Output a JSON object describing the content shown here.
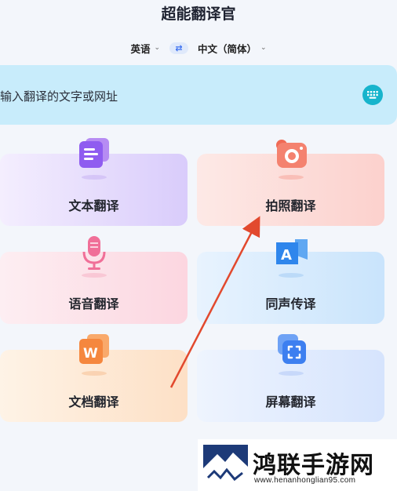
{
  "app": {
    "title": "超能翻译官"
  },
  "languages": {
    "source": "英语",
    "target": "中文（简体）"
  },
  "input": {
    "placeholder": "输入翻译的文字或网址"
  },
  "features": [
    {
      "label": "文本翻译",
      "icon": "document-text-icon"
    },
    {
      "label": "拍照翻译",
      "icon": "camera-icon"
    },
    {
      "label": "语音翻译",
      "icon": "microphone-icon"
    },
    {
      "label": "同声传译",
      "icon": "simultaneous-interpretation-icon"
    },
    {
      "label": "文档翻译",
      "icon": "word-document-icon"
    },
    {
      "label": "屏幕翻译",
      "icon": "screen-translate-icon"
    }
  ],
  "watermark": {
    "title": "鸿联手游网",
    "url": "www.henanhonglian95.com"
  },
  "colors": {
    "accent": "#17b4cc",
    "arrow": "#e2492e"
  }
}
